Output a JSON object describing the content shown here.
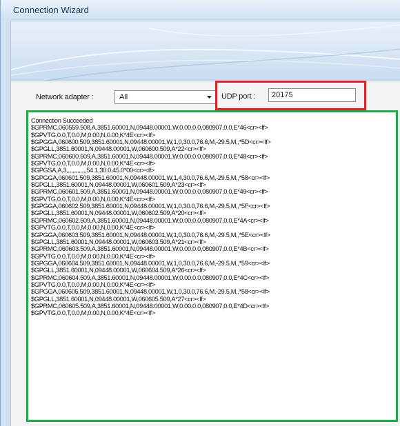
{
  "window": {
    "title": "Connection Wizard"
  },
  "network_adapter": {
    "label": "Network adapter :",
    "value": "All"
  },
  "udp": {
    "label": "UDP port :",
    "value": "20175"
  },
  "log": {
    "lines": [
      "Connection Succeeded",
      "$GPRMC,060559.508,A,3851.60001,N,09448.00001,W,0.00,0.0,080907,0.0,E*46<cr><lf>",
      "$GPVTG,0.0,T,0.0,M,0.00,N,0.00,K*4E<cr><lf>",
      "$GPGGA,060600.509,3851.60001,N,09448.00001,W,1,0,30.0,76.6,M,-29.5,M,,*5D<cr><lf>",
      "$GPGLL,3851.60001,N,09448.00001,W,060600.509,A*22<cr><lf>",
      "$GPRMC,060600.509,A,3851.60001,N,09448.00001,W,0.00,0.0,080907,0.0,E*48<cr><lf>",
      "$GPVTG,0.0,T,0.0,M,0.00,N,0.00,K*4E<cr><lf>",
      "$GPGSA,A,3,,,,,,,,,,,,,54.1,30.0,45.0*00<cr><lf>",
      "$GPGGA,060601.509,3851.60001,N,09448.00001,W,1,4,30.0,76.6,M,-29.5,M,,*58<cr><lf>",
      "$GPGLL,3851.60001,N,09448.00001,W,060601.509,A*23<cr><lf>",
      "$GPRMC,060601.509,A,3851.60001,N,09448.00001,W,0.00,0.0,080907,0.0,E*49<cr><lf>",
      "$GPVTG,0.0,T,0.0,M,0.00,N,0.00,K*4E<cr><lf>",
      "$GPGGA,060602.509,3851.60001,N,09448.00001,W,1,0,30.0,76.6,M,-29.5,M,,*5F<cr><lf>",
      "$GPGLL,3851.60001,N,09448.00001,W,060602.509,A*20<cr><lf>",
      "$GPRMC,060602.509,A,3851.60001,N,09448.00001,W,0.00,0.0,080907,0.0,E*4A<cr><lf>",
      "$GPVTG,0.0,T,0.0,M,0.00,N,0.00,K*4E<cr><lf>",
      "$GPGGA,060603.509,3851.60001,N,09448.00001,W,1,0,30.0,76.6,M,-29.5,M,,*5E<cr><lf>",
      "$GPGLL,3851.60001,N,09448.00001,W,060603.509,A*21<cr><lf>",
      "$GPRMC,060603.509,A,3851.60001,N,09448.00001,W,0.00,0.0,080907,0.0,E*4B<cr><lf>",
      "$GPVTG,0.0,T,0.0,M,0.00,N,0.00,K*4E<cr><lf>",
      "$GPGGA,060604.509,3851.60001,N,09448.00001,W,1,0,30.0,76.6,M,-29.5,M,,*59<cr><lf>",
      "$GPGLL,3851.60001,N,09448.00001,W,060604.509,A*26<cr><lf>",
      "$GPRMC,060604.509,A,3851.60001,N,09448.00001,W,0.00,0.0,080907,0.0,E*4C<cr><lf>",
      "$GPVTG,0.0,T,0.0,M,0.00,N,0.00,K*4E<cr><lf>",
      "$GPGGA,060605.509,3851.60001,N,09448.00001,W,1,0,30.0,76.6,M,-29.5,M,,*58<cr><lf>",
      "$GPGLL,3851.60001,N,09448.00001,W,060605.509,A*27<cr><lf>",
      "$GPRMC,060605.509,A,3851.60001,N,09448.00001,W,0.00,0.0,080907,0.0,E*4D<cr><lf>",
      "$GPVTG,0.0,T,0.0,M,0.00,N,0.00,K*4E<cr><lf>"
    ]
  },
  "highlight_colors": {
    "udp_port": "#d8232a",
    "log": "#22a84a"
  },
  "icons": {
    "dropdown": "chevron-down-icon"
  }
}
